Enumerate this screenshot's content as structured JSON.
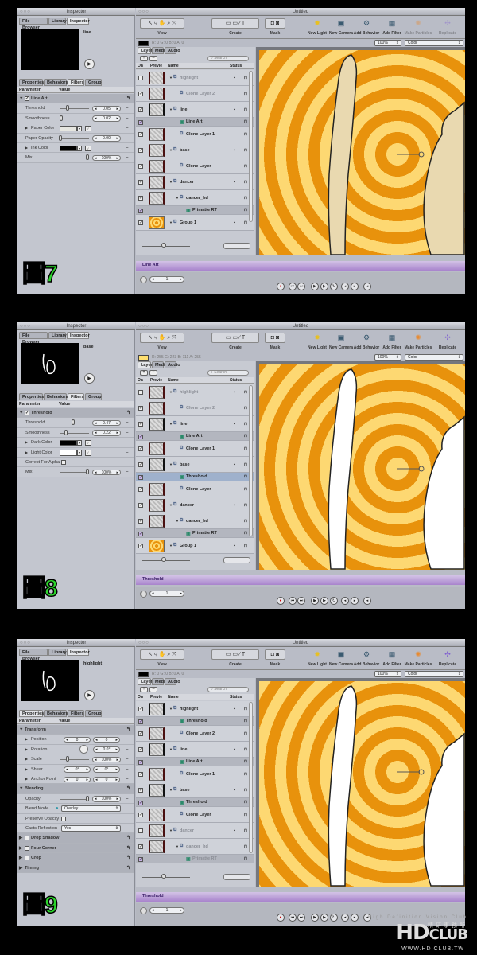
{
  "panels": [
    {
      "label": "圖7",
      "inspector": {
        "window_title": "Inspector",
        "tabs": [
          "File Browser",
          "Library",
          "Inspector"
        ],
        "active_tab": 2,
        "preview_name": "line",
        "preview_figure": false,
        "subtabs": [
          "Properties",
          "Behaviors",
          "Filters",
          "Group"
        ],
        "active_subtab": 2,
        "columns": [
          "Parameter",
          "Value"
        ],
        "params": [
          {
            "type": "group",
            "label": "Line Art",
            "checked": true
          },
          {
            "type": "slider",
            "label": "Threshold",
            "value": "0.05",
            "fraction": 0.25
          },
          {
            "type": "slider",
            "label": "Smoothness",
            "value": "0.02",
            "fraction": 0.02
          },
          {
            "type": "color",
            "label": "Paper Color",
            "color": "#e6e6e0",
            "expand": true
          },
          {
            "type": "slider",
            "label": "Paper Opacity",
            "value": "0.00",
            "fraction": 0
          },
          {
            "type": "color",
            "label": "Ink Color",
            "color": "#000000",
            "expand": true
          },
          {
            "type": "slider",
            "label": "Mix",
            "value": "100%",
            "fraction": 1
          }
        ]
      },
      "window": {
        "title": "Untitled",
        "color_swatch": "#000000",
        "readout": "R: 0   G: 0   B: 0   A: 0",
        "particles_enabled": false,
        "zoom": "100%",
        "view_mode": "Color",
        "timeline_label": "Line Art",
        "frame": "1",
        "layers": [
          {
            "name": "highlight",
            "kind": "group",
            "depth": 0,
            "on": false,
            "dim": true,
            "thumb": "dancer"
          },
          {
            "name": "Clone Layer 2",
            "kind": "clone",
            "depth": 1,
            "on": true,
            "dim": true,
            "thumb": "dancer"
          },
          {
            "name": "line",
            "kind": "group",
            "depth": 0,
            "on": true,
            "thumb": "line"
          },
          {
            "name": "Line Art",
            "kind": "filter",
            "depth": 1,
            "on": true
          },
          {
            "name": "Clone Layer 1",
            "kind": "clone",
            "depth": 1,
            "on": true,
            "thumb": "dancer"
          },
          {
            "name": "base",
            "kind": "group",
            "depth": 0,
            "on": true,
            "thumb": "dancer"
          },
          {
            "name": "Clone Layer",
            "kind": "clone",
            "depth": 1,
            "on": true,
            "thumb": "dancer"
          },
          {
            "name": "dancer",
            "kind": "group",
            "depth": 0,
            "on": true,
            "thumb": "dancer"
          },
          {
            "name": "dancer_hd",
            "kind": "media",
            "depth": 1,
            "on": true,
            "thumb": "dancer"
          },
          {
            "name": "Primatte RT",
            "kind": "filter",
            "depth": 2,
            "on": true
          },
          {
            "name": "Group 1",
            "kind": "group",
            "depth": 0,
            "on": true,
            "thumb": "spiral"
          }
        ],
        "figure_color": "#e9d9b0"
      }
    },
    {
      "label": "圖8",
      "inspector": {
        "window_title": "Inspector",
        "tabs": [
          "File Browser",
          "Library",
          "Inspector"
        ],
        "active_tab": 2,
        "preview_name": "base",
        "preview_figure": true,
        "subtabs": [
          "Properties",
          "Behaviors",
          "Filters",
          "Group"
        ],
        "active_subtab": 2,
        "columns": [
          "Parameter",
          "Value"
        ],
        "params": [
          {
            "type": "group",
            "label": "Threshold",
            "checked": true
          },
          {
            "type": "slider",
            "label": "Threshold",
            "value": "0.47",
            "fraction": 0.47
          },
          {
            "type": "slider",
            "label": "Smoothness",
            "value": "0.22",
            "fraction": 0.22
          },
          {
            "type": "color",
            "label": "Dark Color",
            "color": "#000000",
            "expand": true
          },
          {
            "type": "color",
            "label": "Light Color",
            "color": "#ffffff",
            "expand": true
          },
          {
            "type": "checkbox",
            "label": "Correct For Alpha",
            "checked": false
          },
          {
            "type": "slider",
            "label": "Mix",
            "value": "100%",
            "fraction": 1
          }
        ]
      },
      "window": {
        "title": "Untitled",
        "color_swatch": "#ffdf6f",
        "readout": "R: 255  G: 223  B: 111  A: 255",
        "particles_enabled": true,
        "zoom": "100%",
        "view_mode": "Color",
        "timeline_label": "Threshold",
        "frame": "1",
        "layers": [
          {
            "name": "highlight",
            "kind": "group",
            "depth": 0,
            "on": false,
            "dim": true,
            "thumb": "dancer"
          },
          {
            "name": "Clone Layer 2",
            "kind": "clone",
            "depth": 1,
            "on": true,
            "dim": true,
            "thumb": "dancer"
          },
          {
            "name": "line",
            "kind": "group",
            "depth": 0,
            "on": true,
            "thumb": "line"
          },
          {
            "name": "Line Art",
            "kind": "filter",
            "depth": 1,
            "on": true
          },
          {
            "name": "Clone Layer 1",
            "kind": "clone",
            "depth": 1,
            "on": true,
            "thumb": "dancer"
          },
          {
            "name": "base",
            "kind": "group",
            "depth": 0,
            "on": true,
            "thumb": "base"
          },
          {
            "name": "Threshold",
            "kind": "filter",
            "depth": 1,
            "on": true,
            "selected": true
          },
          {
            "name": "Clone Layer",
            "kind": "clone",
            "depth": 1,
            "on": true,
            "thumb": "dancer"
          },
          {
            "name": "dancer",
            "kind": "group",
            "depth": 0,
            "on": true,
            "thumb": "dancer"
          },
          {
            "name": "dancer_hd",
            "kind": "media",
            "depth": 1,
            "on": true,
            "thumb": "dancer"
          },
          {
            "name": "Primatte RT",
            "kind": "filter",
            "depth": 2,
            "on": true
          },
          {
            "name": "Group 1",
            "kind": "group",
            "depth": 0,
            "on": true,
            "thumb": "spiral"
          }
        ],
        "figure_color": "#ffffff"
      }
    },
    {
      "label": "圖9",
      "inspector": {
        "window_title": "Inspector",
        "tabs": [
          "File Browser",
          "Library",
          "Inspector"
        ],
        "active_tab": 2,
        "preview_name": "highlight",
        "preview_figure": true,
        "subtabs": [
          "Properties",
          "Behaviors",
          "Filters",
          "Group"
        ],
        "active_subtab": 0,
        "columns": [
          "Parameter",
          "Value"
        ],
        "params": [
          {
            "type": "section",
            "label": "Transform"
          },
          {
            "type": "xy",
            "label": "Position",
            "values": [
              "0",
              "0"
            ]
          },
          {
            "type": "dial",
            "label": "Rotation",
            "value": "0.0°"
          },
          {
            "type": "slider",
            "label": "Scale",
            "value": "100%",
            "fraction": 0.25,
            "expand": true
          },
          {
            "type": "xy",
            "label": "Shear",
            "values": [
              "0°",
              "0°"
            ]
          },
          {
            "type": "xy",
            "label": "Anchor Point",
            "values": [
              "0",
              "0"
            ]
          },
          {
            "type": "section",
            "label": "Blending"
          },
          {
            "type": "slider",
            "label": "Opacity",
            "value": "100%",
            "fraction": 1
          },
          {
            "type": "select",
            "label": "Blend Mode",
            "value": "Overlay"
          },
          {
            "type": "checkbox",
            "label": "Preserve Opacity",
            "checked": false
          },
          {
            "type": "select",
            "label": "Casts Reflection",
            "value": "Yes"
          },
          {
            "type": "group",
            "label": "Drop Shadow",
            "checked": false
          },
          {
            "type": "group",
            "label": "Four Corner",
            "checked": false
          },
          {
            "type": "group",
            "label": "Crop",
            "checked": false
          },
          {
            "type": "section",
            "label": "Timing",
            "collapsed": true
          }
        ]
      },
      "window": {
        "title": "Untitled",
        "color_swatch": "#000000",
        "readout": "R: 0   G: 0   B: 0   A: 0",
        "particles_enabled": true,
        "zoom": "100%",
        "view_mode": "Color",
        "timeline_label": "Threshold",
        "frame": "1",
        "layers": [
          {
            "name": "highlight",
            "kind": "group",
            "depth": 0,
            "on": true,
            "thumb": "base"
          },
          {
            "name": "Threshold",
            "kind": "filter",
            "depth": 1,
            "on": true
          },
          {
            "name": "Clone Layer 2",
            "kind": "clone",
            "depth": 1,
            "on": true,
            "thumb": "dancer"
          },
          {
            "name": "line",
            "kind": "group",
            "depth": 0,
            "on": true,
            "thumb": "line"
          },
          {
            "name": "Line Art",
            "kind": "filter",
            "depth": 1,
            "on": true
          },
          {
            "name": "Clone Layer 1",
            "kind": "clone",
            "depth": 1,
            "on": true,
            "thumb": "dancer"
          },
          {
            "name": "base",
            "kind": "group",
            "depth": 0,
            "on": true,
            "thumb": "base"
          },
          {
            "name": "Threshold",
            "kind": "filter",
            "depth": 1,
            "on": true
          },
          {
            "name": "Clone Layer",
            "kind": "clone",
            "depth": 1,
            "on": true,
            "thumb": "dancer"
          },
          {
            "name": "dancer",
            "kind": "group",
            "depth": 0,
            "on": false,
            "dim": true,
            "thumb": "dancer"
          },
          {
            "name": "dancer_hd",
            "kind": "media",
            "depth": 1,
            "on": true,
            "dim": true,
            "thumb": "dancer"
          },
          {
            "name": "Primatte RT",
            "kind": "filter",
            "depth": 2,
            "on": true,
            "dim": true
          }
        ],
        "figure_color": "#ffffff"
      }
    }
  ],
  "toolbar": {
    "groups": [
      "View",
      "Create",
      "Mask"
    ],
    "actions": [
      "New Light",
      "New Camera",
      "Add Behavior",
      "Add Filter",
      "Make Particles",
      "Replicate"
    ],
    "layer_tabs": [
      "Layers",
      "Media",
      "Audio"
    ],
    "search_placeholder": "Search",
    "layer_columns": [
      "On",
      "Previe",
      "Name",
      "Status"
    ]
  },
  "watermark": {
    "tagline": "High Definition Vision Club",
    "chinese": "精研事務所",
    "logo_hd": "HD",
    "logo_club": "CLUB",
    "url": "WWW.HD.CLUB.TW"
  },
  "colors": {
    "orange": "#e8920c",
    "yellow": "#fdd872",
    "timeline": "#b08ad4",
    "badge": "#2bd52b"
  }
}
